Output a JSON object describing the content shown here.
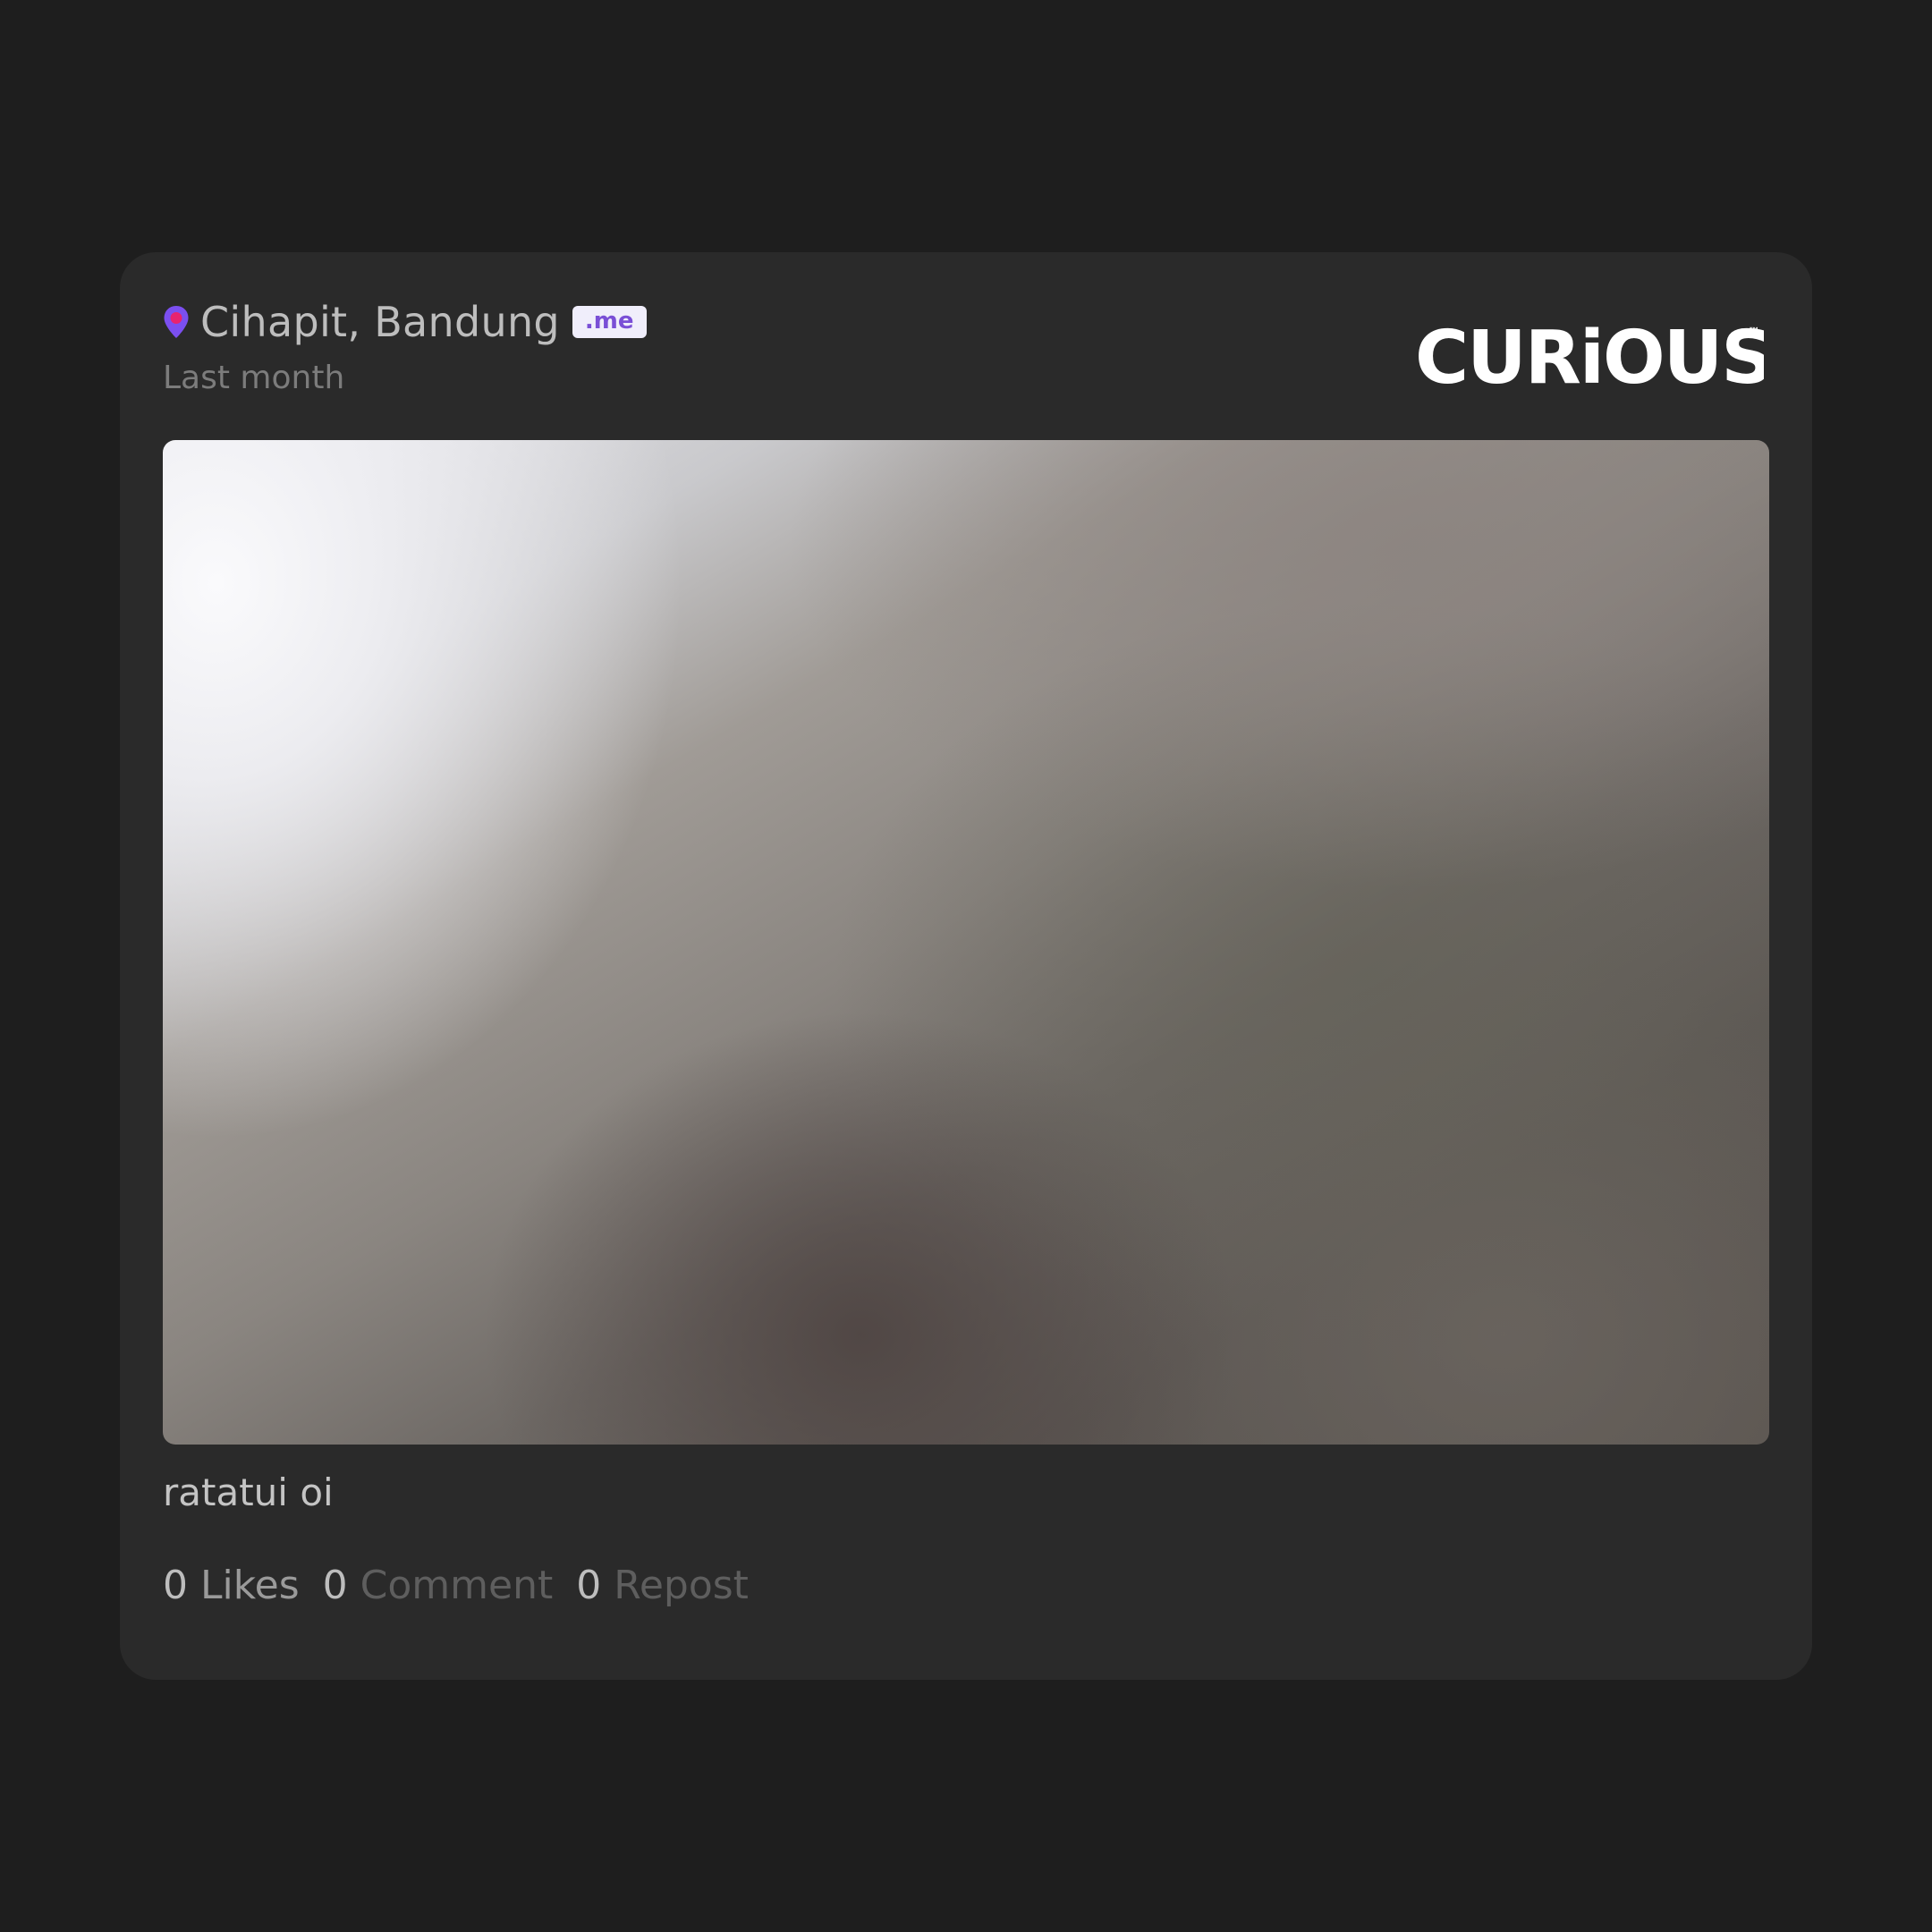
{
  "post": {
    "location": "Cihapit, Bandung",
    "badge": ".me",
    "time": "Last month",
    "caption": "ratatui oi"
  },
  "brand": {
    "logo_text": "CURiOUS",
    "trademark": "™"
  },
  "stats": {
    "likes_count": "0",
    "likes_label": "Likes",
    "comment_count": "0",
    "comment_label": "Comment",
    "repost_count": "0",
    "repost_label": "Repost"
  },
  "colors": {
    "background": "#1e1e1e",
    "card": "#2a2a2a",
    "pin_outer": "#7b4ff0",
    "pin_inner": "#e8236f",
    "badge_text": "#7a4fd6"
  },
  "icons": {
    "location": "map-pin-icon",
    "logo": "curious-logo"
  }
}
